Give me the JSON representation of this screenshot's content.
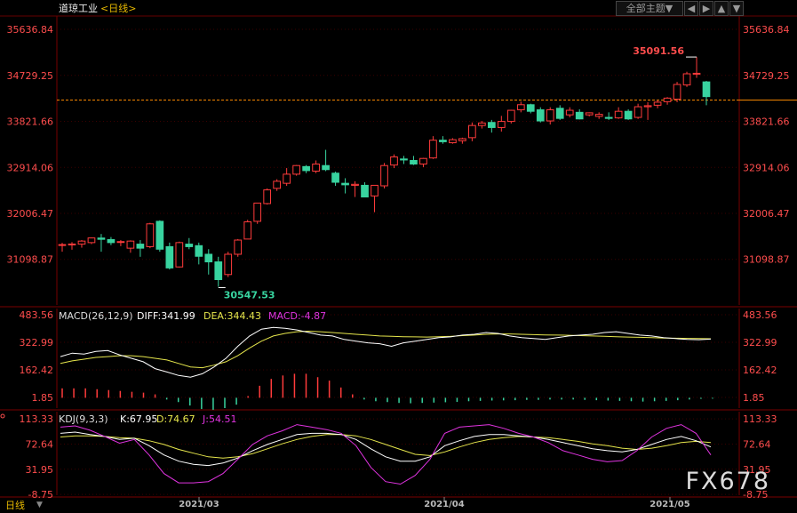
{
  "header": {
    "symbol": "道琼工业",
    "period": "<日线>",
    "theme_select": "全部主题▼",
    "nav_buttons": [
      "◀",
      "▶",
      "▲",
      "▼"
    ]
  },
  "colors": {
    "up": "#ff3b3b",
    "down": "#38d39f",
    "price_axis": "#ff4d4d",
    "grid": "#5a0000",
    "diff": "#ffffff",
    "dea": "#e6e64c",
    "macd_j": "#e033e0",
    "guide": "#ff8c00"
  },
  "price_panel": {
    "y_ticks": [
      "35636.84",
      "34729.25",
      "33821.66",
      "32914.06",
      "32006.47",
      "31098.87"
    ],
    "high_label": "35091.56",
    "low_label": "30547.53",
    "current_price_guide": 34240
  },
  "macd_panel": {
    "header_name": "MACD(26,12,9)",
    "diff_text": "DIFF:341.99",
    "dea_text": "DEA:344.43",
    "macd_text": "MACD:-4.87",
    "y_ticks": [
      "483.56",
      "322.99",
      "162.42",
      "1.85"
    ]
  },
  "kdj_panel": {
    "header_name": "KDJ(9,3,3)",
    "k_text": "K:67.95",
    "d_text": "D:74.67",
    "j_text": "J:54.51",
    "y_ticks": [
      "113.33",
      "72.64",
      "31.95",
      "-8.75"
    ]
  },
  "x_axis": {
    "period_label": "日线",
    "date_labels": [
      "2021/03",
      "2021/04",
      "2021/05"
    ]
  },
  "watermark": "FX678",
  "chart_data": [
    {
      "type": "candlestick",
      "title": "道琼工业 日线",
      "ylim": [
        30200,
        35900
      ],
      "candles": [
        [
          31390,
          31425,
          31250,
          31391
        ],
        [
          31385,
          31440,
          31290,
          31402
        ],
        [
          31400,
          31480,
          31330,
          31460
        ],
        [
          31430,
          31530,
          31400,
          31522
        ],
        [
          31520,
          31600,
          31250,
          31495
        ],
        [
          31490,
          31540,
          31380,
          31430
        ],
        [
          31440,
          31480,
          31360,
          31450
        ],
        [
          31320,
          31475,
          31230,
          31460
        ],
        [
          31400,
          31480,
          31150,
          31320
        ],
        [
          31350,
          31820,
          31320,
          31800
        ],
        [
          31850,
          31870,
          31250,
          31300
        ],
        [
          31350,
          31430,
          30900,
          30930
        ],
        [
          30950,
          31450,
          30940,
          31430
        ],
        [
          31400,
          31520,
          31300,
          31350
        ],
        [
          31370,
          31430,
          31000,
          31160
        ],
        [
          31200,
          31300,
          30800,
          31050
        ],
        [
          31050,
          31150,
          30560,
          30700
        ],
        [
          30800,
          31250,
          30750,
          31200
        ],
        [
          31200,
          31500,
          31150,
          31480
        ],
        [
          31500,
          31880,
          31500,
          31840
        ],
        [
          31850,
          32200,
          31800,
          32210
        ],
        [
          32200,
          32500,
          32180,
          32470
        ],
        [
          32500,
          32680,
          32450,
          32640
        ],
        [
          32600,
          32900,
          32550,
          32780
        ],
        [
          32780,
          32960,
          32750,
          32950
        ],
        [
          32930,
          32960,
          32800,
          32850
        ],
        [
          32840,
          33050,
          32800,
          32980
        ],
        [
          32950,
          33260,
          32840,
          32870
        ],
        [
          32800,
          32830,
          32550,
          32620
        ],
        [
          32600,
          32700,
          32400,
          32570
        ],
        [
          32560,
          32640,
          32330,
          32580
        ],
        [
          32560,
          32620,
          32330,
          32330
        ],
        [
          32350,
          32550,
          32030,
          32560
        ],
        [
          32550,
          33000,
          32500,
          32950
        ],
        [
          32960,
          33170,
          32900,
          33120
        ],
        [
          33080,
          33140,
          32980,
          33060
        ],
        [
          33050,
          33140,
          32960,
          32980
        ],
        [
          32980,
          33100,
          32920,
          33090
        ],
        [
          33100,
          33530,
          33080,
          33450
        ],
        [
          33450,
          33530,
          33380,
          33420
        ],
        [
          33400,
          33490,
          33380,
          33460
        ],
        [
          33440,
          33500,
          33380,
          33480
        ],
        [
          33500,
          33800,
          33430,
          33740
        ],
        [
          33740,
          33830,
          33680,
          33790
        ],
        [
          33800,
          33850,
          33600,
          33700
        ],
        [
          33700,
          33930,
          33620,
          33820
        ],
        [
          33820,
          34050,
          33780,
          34040
        ],
        [
          34050,
          34210,
          34000,
          34150
        ],
        [
          34150,
          34170,
          33980,
          34020
        ],
        [
          34050,
          34100,
          33800,
          33830
        ],
        [
          33830,
          34100,
          33760,
          34050
        ],
        [
          34080,
          34140,
          33850,
          33880
        ],
        [
          33950,
          34100,
          33900,
          34040
        ],
        [
          34000,
          34060,
          33860,
          33870
        ],
        [
          33950,
          34000,
          33920,
          33990
        ],
        [
          33920,
          34000,
          33870,
          33960
        ],
        [
          33900,
          34000,
          33850,
          33880
        ],
        [
          33890,
          34100,
          33870,
          34020
        ],
        [
          34020,
          34060,
          33850,
          33870
        ],
        [
          33900,
          34170,
          33870,
          34110
        ],
        [
          34110,
          34200,
          33850,
          34130
        ],
        [
          34140,
          34240,
          34080,
          34200
        ],
        [
          34210,
          34300,
          34150,
          34280
        ],
        [
          34260,
          34600,
          34200,
          34550
        ],
        [
          34540,
          34800,
          34500,
          34760
        ],
        [
          34760,
          35091.56,
          34680,
          34770
        ],
        [
          34600,
          34620,
          34140,
          34310
        ]
      ]
    },
    {
      "type": "macd",
      "title": "MACD(26,12,9)",
      "ylim": [
        -60,
        520
      ],
      "diff": [
        240,
        260,
        255,
        270,
        275,
        250,
        230,
        210,
        170,
        150,
        130,
        120,
        140,
        180,
        230,
        300,
        360,
        400,
        410,
        405,
        395,
        380,
        365,
        360,
        340,
        330,
        320,
        315,
        300,
        320,
        330,
        340,
        350,
        355,
        365,
        370,
        380,
        375,
        360,
        350,
        345,
        340,
        350,
        360,
        365,
        370,
        380,
        385,
        375,
        365,
        360,
        350,
        345,
        340,
        338,
        342
      ],
      "dea": [
        200,
        215,
        225,
        235,
        240,
        245,
        245,
        240,
        230,
        220,
        200,
        180,
        175,
        190,
        210,
        245,
        290,
        330,
        360,
        375,
        385,
        388,
        385,
        380,
        375,
        370,
        365,
        360,
        358,
        356,
        355,
        354,
        356,
        358,
        362,
        365,
        370,
        372,
        372,
        370,
        368,
        366,
        365,
        364,
        362,
        360,
        358,
        356,
        354,
        352,
        350,
        348,
        347,
        346,
        345,
        344
      ],
      "histogram": [
        55,
        55,
        55,
        50,
        45,
        40,
        35,
        30,
        20,
        -10,
        -25,
        -45,
        -65,
        -70,
        -60,
        -40,
        10,
        70,
        110,
        130,
        140,
        140,
        120,
        100,
        60,
        20,
        -10,
        -20,
        -25,
        -30,
        -32,
        -30,
        -28,
        -26,
        -24,
        -20,
        -18,
        -16,
        -15,
        -14,
        -12,
        -12,
        -10,
        -10,
        -10,
        -12,
        -14,
        -16,
        -18,
        -20,
        -22,
        -20,
        -18,
        -14,
        -10,
        -6,
        -5
      ]
    },
    {
      "type": "kdj",
      "title": "KDJ(9,3,3)",
      "ylim": [
        -10,
        125
      ],
      "k": [
        90,
        92,
        88,
        85,
        80,
        82,
        70,
        55,
        45,
        40,
        38,
        42,
        50,
        62,
        72,
        80,
        88,
        90,
        90,
        88,
        80,
        65,
        52,
        45,
        45,
        52,
        70,
        78,
        85,
        88,
        88,
        86,
        84,
        80,
        75,
        70,
        65,
        62,
        60,
        64,
        72,
        80,
        85,
        78,
        68
      ],
      "d": [
        84,
        86,
        86,
        85,
        83,
        82,
        78,
        72,
        64,
        58,
        52,
        50,
        52,
        57,
        65,
        73,
        80,
        85,
        88,
        88,
        86,
        80,
        72,
        64,
        56,
        54,
        60,
        68,
        75,
        80,
        83,
        85,
        84,
        83,
        80,
        77,
        73,
        70,
        66,
        64,
        66,
        70,
        75,
        77,
        75
      ],
      "j": [
        100,
        102,
        95,
        85,
        74,
        80,
        55,
        25,
        10,
        10,
        12,
        25,
        48,
        72,
        86,
        94,
        104,
        100,
        96,
        90,
        70,
        35,
        12,
        8,
        22,
        48,
        90,
        100,
        102,
        104,
        98,
        90,
        84,
        75,
        62,
        55,
        48,
        44,
        46,
        62,
        84,
        98,
        104,
        90,
        55
      ]
    }
  ]
}
